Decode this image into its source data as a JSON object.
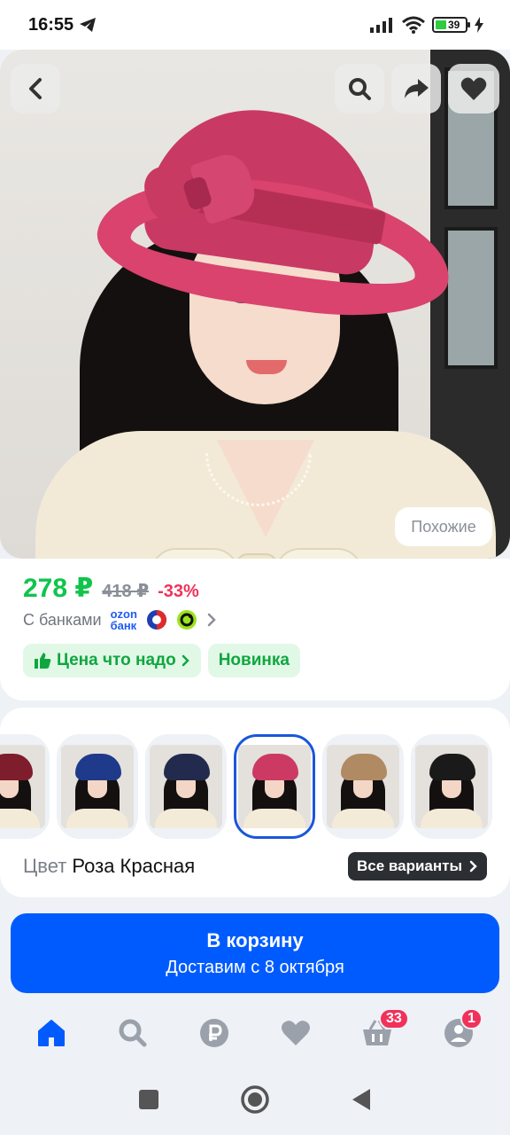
{
  "status_bar": {
    "time": "16:55",
    "battery": "39"
  },
  "product": {
    "similar_label": "Похожие"
  },
  "price": {
    "current": "278 ₽",
    "old": "418 ₽",
    "discount": "-33%",
    "banks_label": "С банками",
    "ozon_bank_line1": "ozon",
    "ozon_bank_line2": "банк"
  },
  "badges": [
    {
      "label": "Цена что надо"
    },
    {
      "label": "Новинка"
    }
  ],
  "variants": {
    "color_label": "Цвет",
    "color_value": "Роза Красная",
    "all_label": "Все варианты",
    "thumbs": [
      {
        "hat_color": "#7e1d2c"
      },
      {
        "hat_color": "#1f3a8a"
      },
      {
        "hat_color": "#222b4d"
      },
      {
        "hat_color": "#cc3a63",
        "selected": true
      },
      {
        "hat_color": "#b08a62"
      },
      {
        "hat_color": "#1a1a1a"
      }
    ]
  },
  "cart": {
    "title": "В корзину",
    "subtitle": "Доставим с 8 октября"
  },
  "tabbar": {
    "cart_count": "33",
    "profile_count": "1"
  },
  "colors": {
    "accent_blue": "#005bff",
    "price_green": "#10c44c",
    "discount_pink": "#f0325a",
    "active_tab": "#005bff",
    "inactive_tab": "#9aa1ab"
  }
}
